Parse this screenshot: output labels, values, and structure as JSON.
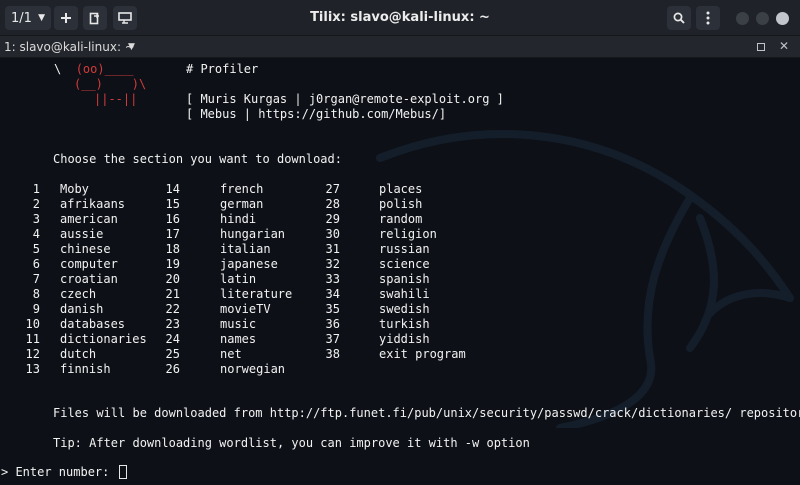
{
  "titlebar": {
    "session": "1/1",
    "title": "Tilix: slavo@kali-linux: ~"
  },
  "tab": {
    "label": "1: slavo@kali-linux: ~"
  },
  "banner": {
    "line1_left": "\\",
    "line1_art": "(oo)____",
    "line1_right": "# Profiler",
    "line2_art": "(__)    )\\",
    "line3_art": "||--||",
    "line3_right": "[ Muris Kurgas | j0rgan@remote-exploit.org ]",
    "line4_right": "[ Mebus | https://github.com/Mebus/]"
  },
  "prompt_heading": "Choose the section you want to download:",
  "options": [
    {
      "num": "1",
      "label": "Moby"
    },
    {
      "num": "2",
      "label": "afrikaans"
    },
    {
      "num": "3",
      "label": "american"
    },
    {
      "num": "4",
      "label": "aussie"
    },
    {
      "num": "5",
      "label": "chinese"
    },
    {
      "num": "6",
      "label": "computer"
    },
    {
      "num": "7",
      "label": "croatian"
    },
    {
      "num": "8",
      "label": "czech"
    },
    {
      "num": "9",
      "label": "danish"
    },
    {
      "num": "10",
      "label": "databases"
    },
    {
      "num": "11",
      "label": "dictionaries"
    },
    {
      "num": "12",
      "label": "dutch"
    },
    {
      "num": "13",
      "label": "finnish"
    },
    {
      "num": "14",
      "label": "french"
    },
    {
      "num": "15",
      "label": "german"
    },
    {
      "num": "16",
      "label": "hindi"
    },
    {
      "num": "17",
      "label": "hungarian"
    },
    {
      "num": "18",
      "label": "italian"
    },
    {
      "num": "19",
      "label": "japanese"
    },
    {
      "num": "20",
      "label": "latin"
    },
    {
      "num": "21",
      "label": "literature"
    },
    {
      "num": "22",
      "label": "movieTV"
    },
    {
      "num": "23",
      "label": "music"
    },
    {
      "num": "24",
      "label": "names"
    },
    {
      "num": "25",
      "label": "net"
    },
    {
      "num": "26",
      "label": "norwegian"
    },
    {
      "num": "27",
      "label": "places"
    },
    {
      "num": "28",
      "label": "polish"
    },
    {
      "num": "29",
      "label": "random"
    },
    {
      "num": "30",
      "label": "religion"
    },
    {
      "num": "31",
      "label": "russian"
    },
    {
      "num": "32",
      "label": "science"
    },
    {
      "num": "33",
      "label": "spanish"
    },
    {
      "num": "34",
      "label": "swahili"
    },
    {
      "num": "35",
      "label": "swedish"
    },
    {
      "num": "36",
      "label": "turkish"
    },
    {
      "num": "37",
      "label": "yiddish"
    },
    {
      "num": "38",
      "label": "exit program"
    }
  ],
  "download_info": "Files will be downloaded from http://ftp.funet.fi/pub/unix/security/passwd/crack/dictionaries/ repository",
  "tip": "Tip: After downloading wordlist, you can improve it with -w option",
  "input_prompt": "> Enter number:",
  "colors": {
    "art_red": "#d23b3b",
    "terminal_bg": "#0d1117",
    "titlebar_bg": "#1f2228"
  }
}
